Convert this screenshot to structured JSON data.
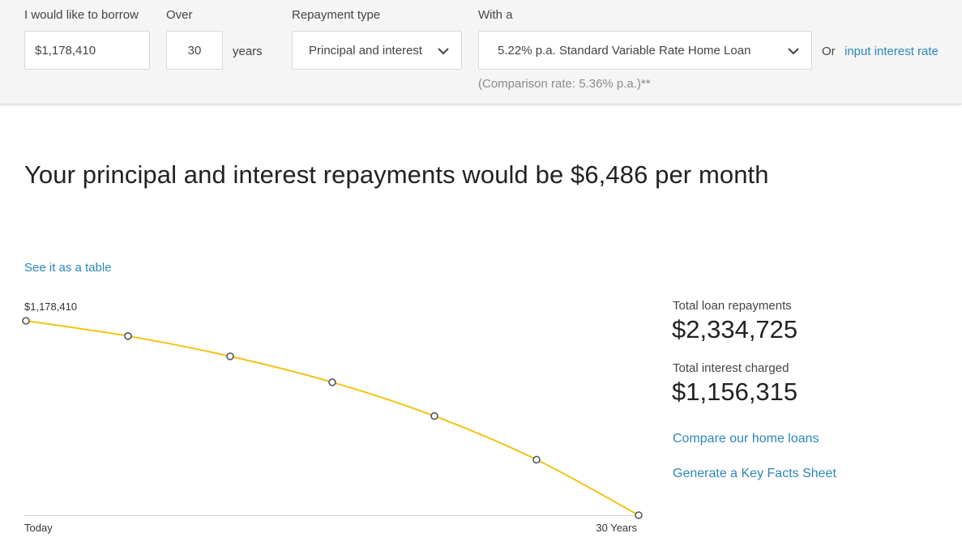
{
  "form": {
    "borrow_label": "I would like to borrow",
    "borrow_value": "$1,178,410",
    "over_label": "Over",
    "years_value": "30",
    "years_unit": "years",
    "repayment_label": "Repayment type",
    "repayment_value": "Principal and interest",
    "rate_label": "With a",
    "rate_value": "5.22% p.a. Standard Variable Rate Home Loan",
    "or_text": "Or",
    "input_rate_link": "input interest rate",
    "comparison_rate": "(Comparison rate: 5.36% p.a.)**"
  },
  "result": {
    "headline": "Your principal and interest repayments would be $6,486 per month",
    "see_table_link": "See it as a table"
  },
  "totals": {
    "repayments_label": "Total loan repayments",
    "repayments_value": "$2,334,725",
    "interest_label": "Total interest charged",
    "interest_value": "$1,156,315",
    "compare_link": "Compare our home loans",
    "key_facts_link": "Generate a Key Facts Sheet"
  },
  "colors": {
    "line": "#f2c314",
    "link": "#2e86b9",
    "point_stroke": "#555555"
  },
  "chart_data": {
    "type": "line",
    "title": "",
    "xlabel": "",
    "ylabel": "",
    "x": [
      0,
      5,
      10,
      15,
      20,
      25,
      30
    ],
    "x_tick_labels": [
      "Today",
      "30 Years"
    ],
    "y_start_label": "$1,178,410",
    "series": [
      {
        "values": [
          1178410,
          1086000,
          963000,
          806000,
          601000,
          337000,
          0
        ]
      }
    ],
    "ylim": [
      0,
      1178410
    ],
    "grid": false
  }
}
